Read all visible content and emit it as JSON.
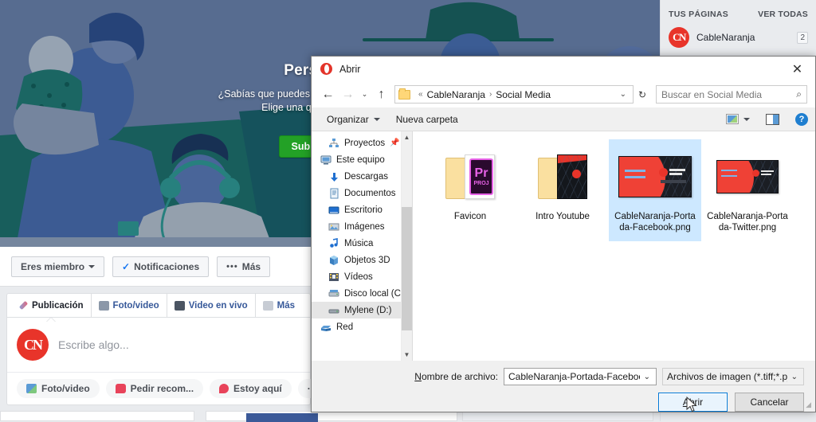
{
  "facebook": {
    "cover": {
      "title": "Personalizar",
      "subtitle_line1": "¿Sabías que puedes agregar una foto de portada?",
      "subtitle_line2": "Elige una que defina la página.",
      "upload_button": "Subir foto",
      "secondary_button": ""
    },
    "page_nav": {
      "member_button": "Eres miembro",
      "notifications_button": "Notificaciones",
      "more_button": "Más"
    },
    "composer": {
      "tabs": [
        {
          "label": "Publicación",
          "icon": "pencil-icon"
        },
        {
          "label": "Foto/video",
          "icon": "photo-icon"
        },
        {
          "label": "Video en vivo",
          "icon": "live-video-icon"
        },
        {
          "label": "Más",
          "icon": "ellipsis-icon"
        }
      ],
      "avatar_initials": "CN",
      "placeholder": "Escribe algo...",
      "actions": [
        {
          "label": "Foto/video",
          "icon": "photo-icon"
        },
        {
          "label": "Pedir recom...",
          "icon": "recommendation-icon"
        },
        {
          "label": "Estoy aquí",
          "icon": "location-pin-icon"
        },
        {
          "label": "···",
          "icon": "ellipsis-icon"
        }
      ]
    },
    "right_column": {
      "heading": "TUS PÁGINAS",
      "see_all": "VER TODAS",
      "pages": [
        {
          "name": "CableNaranja",
          "initials": "CN",
          "badge": "2"
        }
      ]
    }
  },
  "dialog": {
    "title": "Abrir",
    "close_label": "✕",
    "nav": {
      "back": "←",
      "forward": "→",
      "recent": "⌄",
      "up": "↑"
    },
    "breadcrumb": {
      "prefix": "«",
      "parts": [
        "CableNaranja",
        "Social Media"
      ],
      "separator": "›"
    },
    "search": {
      "placeholder": "Buscar en Social Media"
    },
    "toolbar": {
      "organize": "Organizar",
      "new_folder": "Nueva carpeta",
      "view_icon": "view-layout-icon",
      "preview_pane_icon": "preview-pane-icon",
      "help_icon": "help-icon",
      "help_glyph": "?"
    },
    "tree": [
      {
        "label": "Proyectos",
        "icon": "network-folder-icon",
        "indent": true,
        "pinned": true,
        "selected": false
      },
      {
        "label": "Este equipo",
        "icon": "this-pc-icon",
        "indent": false,
        "pinned": false,
        "selected": false
      },
      {
        "label": "Descargas",
        "icon": "downloads-icon",
        "indent": true,
        "pinned": false,
        "selected": false
      },
      {
        "label": "Documentos",
        "icon": "documents-icon",
        "indent": true,
        "pinned": false,
        "selected": false
      },
      {
        "label": "Escritorio",
        "icon": "desktop-icon",
        "indent": true,
        "pinned": false,
        "selected": false
      },
      {
        "label": "Imágenes",
        "icon": "pictures-icon",
        "indent": true,
        "pinned": false,
        "selected": false
      },
      {
        "label": "Música",
        "icon": "music-icon",
        "indent": true,
        "pinned": false,
        "selected": false
      },
      {
        "label": "Objetos 3D",
        "icon": "objects3d-icon",
        "indent": true,
        "pinned": false,
        "selected": false
      },
      {
        "label": "Vídeos",
        "icon": "videos-icon",
        "indent": true,
        "pinned": false,
        "selected": false
      },
      {
        "label": "Disco local (C:)",
        "icon": "harddrive-icon",
        "indent": true,
        "pinned": false,
        "selected": false
      },
      {
        "label": "Mylene (D:)",
        "icon": "drive-icon",
        "indent": true,
        "pinned": false,
        "selected": true
      },
      {
        "label": "Red",
        "icon": "network-icon",
        "indent": false,
        "pinned": false,
        "selected": false
      }
    ],
    "files": [
      {
        "label": "Favicon",
        "kind": "folder-pr",
        "selected": false
      },
      {
        "label": "Intro Youtube",
        "kind": "folder-video",
        "selected": false
      },
      {
        "label": "CableNaranja-Portada-Facebook.png",
        "kind": "image-large",
        "selected": true
      },
      {
        "label": "CableNaranja-Portada-Twitter.png",
        "kind": "image-small",
        "selected": false
      }
    ],
    "bottom": {
      "filename_label_prefix": "N",
      "filename_label_rest": "ombre de archivo:",
      "filename_value": "CableNaranja-Portada-Facebook.pr",
      "filetype_value": "Archivos de imagen (*.tiff;*.pjp",
      "open_button_prefix": "A",
      "open_button_rest": "brir",
      "cancel_button": "Cancelar"
    }
  },
  "colors": {
    "accent_blue": "#1877f2",
    "brand_red": "#e8342a",
    "green_button": "#23a126",
    "selection_blue": "#cde8ff",
    "focus_blue": "#0078d7"
  }
}
